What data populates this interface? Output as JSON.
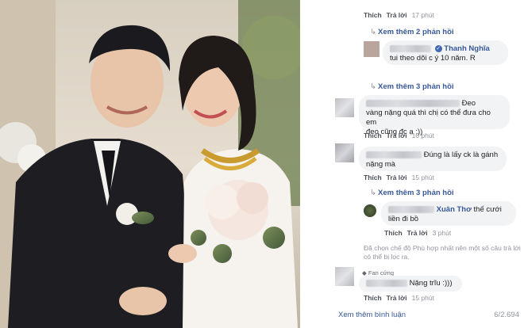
{
  "comments_panel": {
    "top_meta": {
      "like": "Thích",
      "reply": "Trả lời",
      "time": "17 phút"
    },
    "more_1": "Xem thêm 2 phản hồi",
    "reply_1": {
      "name": "Thanh Nghĩa",
      "text": "tui theo dõi c ý 10 năm. R"
    },
    "more_2": "Xem thêm 3 phản hồi",
    "comment_1": {
      "text_1": "Đeo",
      "text_2": "vàng nặng quá thì chị có thể đưa cho em",
      "text_3": "đeo cũng đc ạ :))"
    },
    "comment_1_meta": {
      "like": "Thích",
      "reply": "Trả lời",
      "time": "16 phút"
    },
    "comment_2": {
      "text_1": "Đúng là lấy ck là gánh",
      "text_2": "nặng mà"
    },
    "comment_2_meta": {
      "like": "Thích",
      "reply": "Trả lời",
      "time": "15 phút"
    },
    "more_3": "Xem thêm 3 phản hồi",
    "reply_2": {
      "name": "Xuân Thơ",
      "text_1": "thế cưới",
      "text_2": "liền đi bồ"
    },
    "reply_2_meta": {
      "like": "Thích",
      "reply": "Trả lời",
      "time": "3 phút"
    },
    "notice": "Đã chọn chế độ Phù hợp nhất nên một số câu trả lời có thể bị lọc ra.",
    "fan_badge": "Fan cứng",
    "comment_3": {
      "text": "Nặng trĩu :)))"
    },
    "comment_3_meta": {
      "like": "Thích",
      "reply": "Trả lời",
      "time": "15 phút"
    },
    "footer": {
      "view_more": "Xem thêm bình luận",
      "count": "6/2.694"
    }
  }
}
